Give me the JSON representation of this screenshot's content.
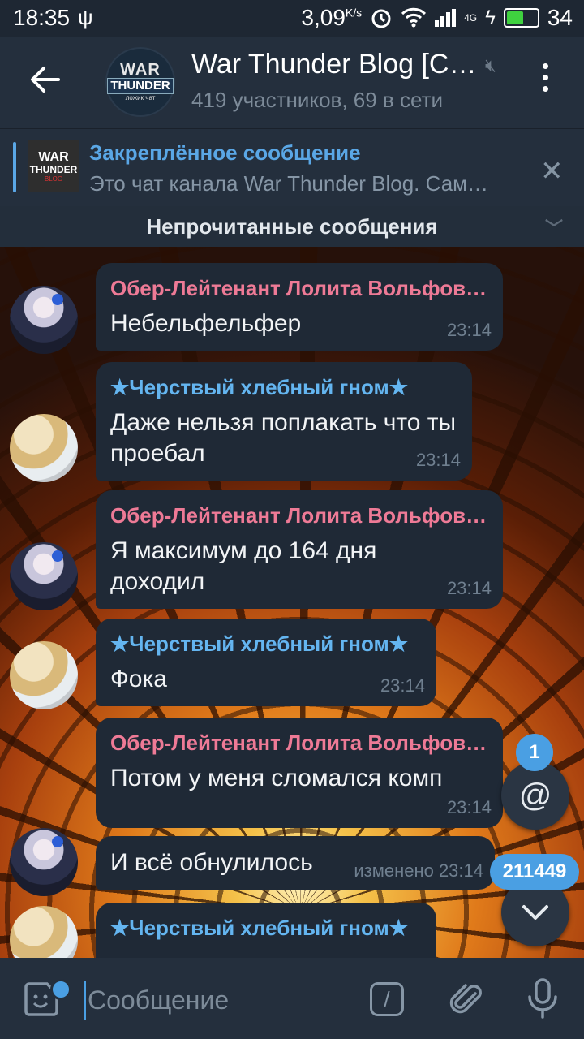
{
  "status_bar": {
    "time": "18:35",
    "speed": "3,09",
    "speed_unit": "K/s",
    "network": "4G",
    "battery": "34"
  },
  "header": {
    "avatar_line1": "WAR",
    "avatar_line2": "THUNDER",
    "avatar_line3": "ложик чат",
    "title": "War Thunder Blog [С…",
    "subtitle": "419 участников, 69 в сети"
  },
  "pinned": {
    "thumb_line1": "WAR",
    "thumb_line2": "THUNDER",
    "thumb_line3": "BLOG",
    "title": "Закреплённое сообщение",
    "text": "Это чат канала War Thunder Blog. Сам…"
  },
  "unread_label": "Непрочитанные сообщения",
  "messages": [
    {
      "sender": "Обер-Лейтенант Лолита Вольфов…",
      "text": "Небельфельфер",
      "time": "23:14"
    },
    {
      "sender": "★Черствый хлебный гном★",
      "text": "Даже нельзя поплакать что ты проебал",
      "time": "23:14"
    },
    {
      "sender": "Обер-Лейтенант Лолита Вольфов…",
      "text": "Я максимум до 164 дня доходил",
      "time": "23:14"
    },
    {
      "sender": "★Черствый хлебный гном★",
      "text": "Фока",
      "time": "23:14"
    },
    {
      "sender": "Обер-Лейтенант Лолита Вольфов…",
      "text": "Потом у меня сломался комп",
      "time": "23:14"
    },
    {
      "sender": "",
      "text": "И всё обнулилось",
      "time": "изменено 23:14"
    },
    {
      "sender": "★Черствый хлебный гном★",
      "text": "",
      "time": ""
    }
  ],
  "mentions": {
    "count": "1",
    "symbol": "@"
  },
  "unread_count": "211449",
  "input": {
    "placeholder": "Сообщение",
    "command_symbol": "/"
  },
  "colors": {
    "sender_a": "#ee7a96",
    "sender_b": "#64b5f0",
    "accent": "#4a9fe3"
  }
}
